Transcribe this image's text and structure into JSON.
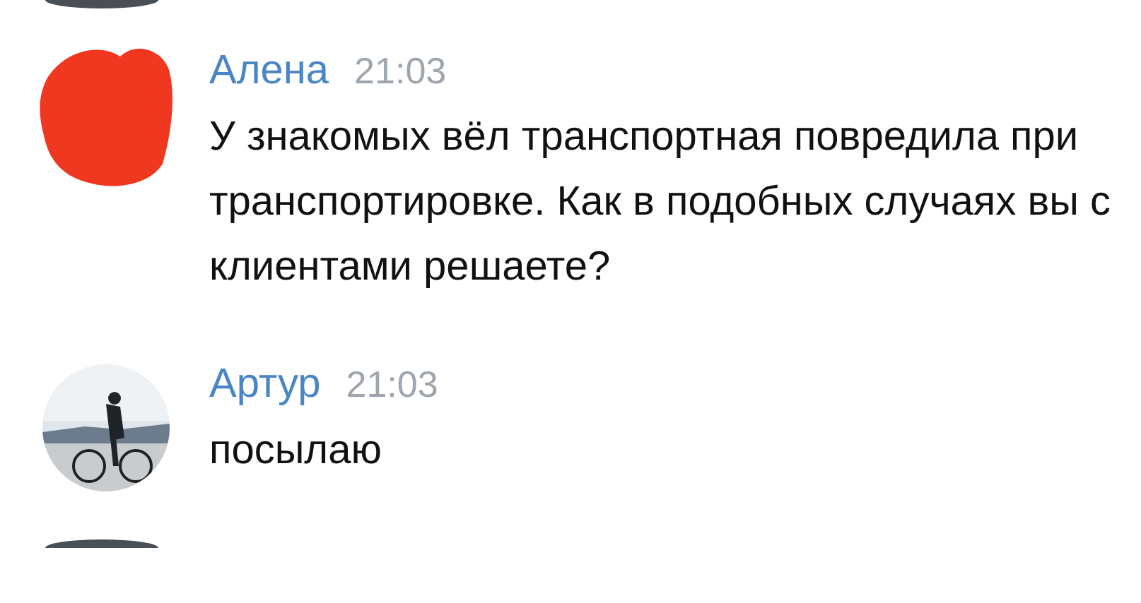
{
  "messages": [
    {
      "author": "Алена",
      "time": "21:03",
      "text": "У знакомых вёл транспортная повредила при транспортировке. Как в подобных случаях вы с клиентами решаете?",
      "avatar": {
        "kind": "redacted"
      }
    },
    {
      "author": "Артур",
      "time": "21:03",
      "text": "посылаю"
    }
  ]
}
